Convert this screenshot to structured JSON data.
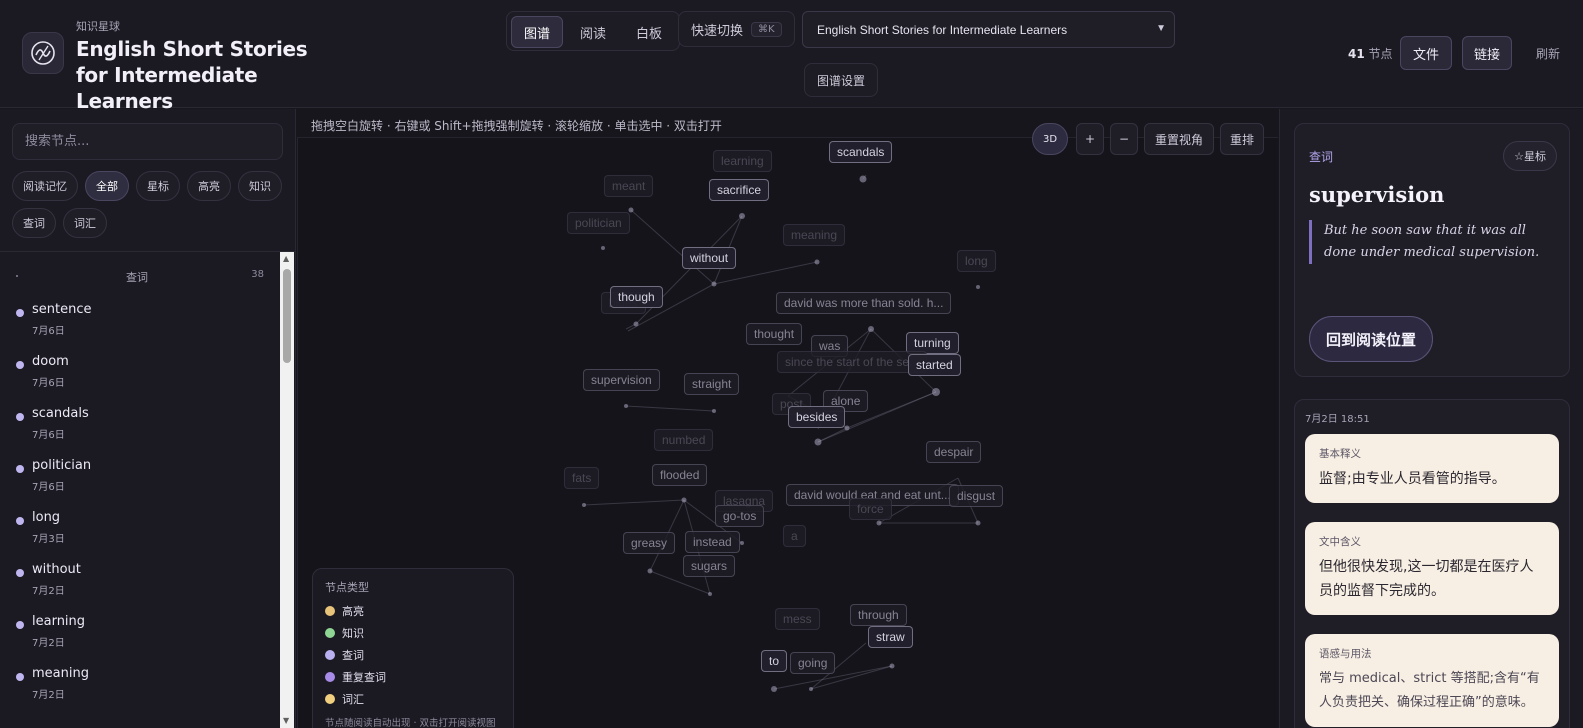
{
  "header": {
    "brand": "知识星球",
    "title": "English Short Stories for Intermediate Learners",
    "view_tabs": [
      {
        "label": "图谱",
        "active": true
      },
      {
        "label": "阅读",
        "active": false
      },
      {
        "label": "白板",
        "active": false
      }
    ],
    "quick_switch_label": "快速切换",
    "quick_switch_kbd": "⌘K",
    "doc_select_value": "English Short Stories for Intermediate Learners",
    "graph_settings_label": "图谱设置",
    "node_count": "41",
    "node_count_unit": "节点",
    "file_label": "文件",
    "link_label": "链接",
    "refresh_label": "刷新"
  },
  "sidebar": {
    "search_placeholder": "搜索节点...",
    "filters": [
      {
        "label": "阅读记忆",
        "active": false
      },
      {
        "label": "全部",
        "active": true
      },
      {
        "label": "星标",
        "active": false
      },
      {
        "label": "高亮",
        "active": false
      },
      {
        "label": "知识",
        "active": false
      },
      {
        "label": "查词",
        "active": false
      },
      {
        "label": "词汇",
        "active": false
      }
    ],
    "group_name": "查词",
    "group_count": "38",
    "items": [
      {
        "word": "sentence",
        "date": "7月6日"
      },
      {
        "word": "doom",
        "date": "7月6日"
      },
      {
        "word": "scandals",
        "date": "7月6日"
      },
      {
        "word": "politician",
        "date": "7月6日"
      },
      {
        "word": "long",
        "date": "7月3日"
      },
      {
        "word": "without",
        "date": "7月2日"
      },
      {
        "word": "learning",
        "date": "7月2日"
      },
      {
        "word": "meaning",
        "date": "7月2日"
      }
    ]
  },
  "graph": {
    "hint": "拖拽空白旋转 · 右键或 Shift+拖拽强制旋转 · 滚轮缩放 · 单击选中 · 双击打开",
    "controls": {
      "mode": "3D",
      "zoom_in": "+",
      "zoom_out": "−",
      "reset_view": "重置视角",
      "relayout": "重排"
    },
    "nodes": [
      {
        "label": "learning"
      },
      {
        "label": "scandals"
      },
      {
        "label": "meant"
      },
      {
        "label": "sacrifice"
      },
      {
        "label": "politician"
      },
      {
        "label": "meaning"
      },
      {
        "label": "without"
      },
      {
        "label": "long"
      },
      {
        "label": "blues"
      },
      {
        "label": "though"
      },
      {
        "label": "david was more than sold. h..."
      },
      {
        "label": "thought"
      },
      {
        "label": "was"
      },
      {
        "label": "turning"
      },
      {
        "label": "since the start of the se..."
      },
      {
        "label": "started"
      },
      {
        "label": "supervision"
      },
      {
        "label": "straight"
      },
      {
        "label": "post"
      },
      {
        "label": "alone"
      },
      {
        "label": "besides"
      },
      {
        "label": "numbed"
      },
      {
        "label": "despair"
      },
      {
        "label": "fats"
      },
      {
        "label": "flooded"
      },
      {
        "label": "lasagna"
      },
      {
        "label": "david would eat and eat unt..."
      },
      {
        "label": "disgust"
      },
      {
        "label": "go-tos"
      },
      {
        "label": "force"
      },
      {
        "label": "a"
      },
      {
        "label": "greasy"
      },
      {
        "label": "instead"
      },
      {
        "label": "sugars"
      },
      {
        "label": "mess"
      },
      {
        "label": "through"
      },
      {
        "label": "straw"
      },
      {
        "label": "to"
      },
      {
        "label": "going"
      }
    ],
    "legend": {
      "title": "节点类型",
      "items": [
        {
          "label": "高亮",
          "color": "#e8c47a"
        },
        {
          "label": "知识",
          "color": "#8fd694"
        },
        {
          "label": "查词",
          "color": "#b8b0f0"
        },
        {
          "label": "重复查词",
          "color": "#a88be8"
        },
        {
          "label": "词汇",
          "color": "#f0cf7e"
        }
      ],
      "note": "节点随阅读自动出现 · 双击打开阅读视图"
    }
  },
  "panel": {
    "type_label": "查词",
    "star_label": "☆星标",
    "word": "supervision",
    "quote": "But he soon saw that it was all done under medical supervision.",
    "back_label": "回到阅读位置",
    "timestamp": "7月2日 18:51",
    "sections": [
      {
        "title": "基本释义",
        "body": "监督;由专业人员看管的指导。"
      },
      {
        "title": "文中含义",
        "body": "但他很快发现,这一切都是在医疗人员的监督下完成的。"
      },
      {
        "title": "语感与用法",
        "body": "常与 medical、strict 等搭配;含有“有人负责把关、确保过程正确”的意味。"
      }
    ]
  },
  "colors": {
    "accent": "#b3a6ec",
    "background": "#17161d",
    "card_cream": "#f7efe3"
  }
}
